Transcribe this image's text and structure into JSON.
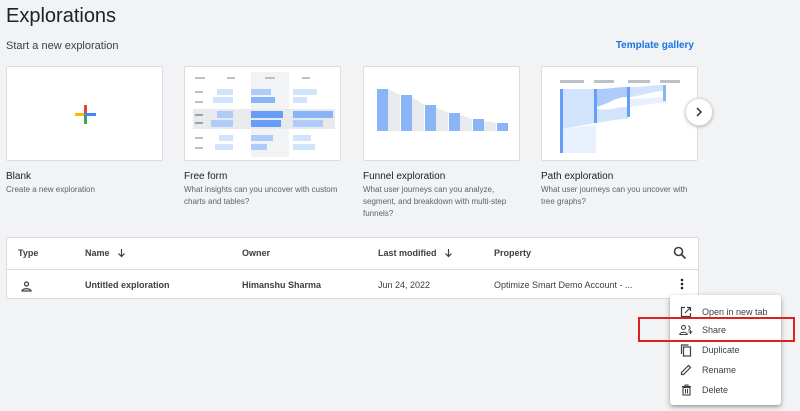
{
  "page": {
    "title": "Explorations"
  },
  "start_section": {
    "label": "Start a new exploration",
    "gallery_link": "Template gallery"
  },
  "templates": [
    {
      "title": "Blank",
      "description": "Create a new exploration"
    },
    {
      "title": "Free form",
      "description": "What insights can you uncover with custom charts and tables?"
    },
    {
      "title": "Funnel exploration",
      "description": "What user journeys can you analyze, segment, and breakdown with multi-step funnels?"
    },
    {
      "title": "Path exploration",
      "description": "What user journeys can you uncover with tree graphs?"
    }
  ],
  "table": {
    "headers": {
      "type": "Type",
      "name": "Name",
      "owner": "Owner",
      "last_modified": "Last modified",
      "property": "Property"
    },
    "rows": [
      {
        "type_icon": "person-icon",
        "name": "Untitled exploration",
        "owner": "Himanshu Sharma",
        "last_modified": "Jun 24, 2022",
        "property": "Optimize Smart Demo Account - ..."
      }
    ]
  },
  "context_menu": {
    "items": [
      {
        "label": "Open in new tab",
        "icon": "open-in-new-icon"
      },
      {
        "label": "Share",
        "icon": "share-person-icon"
      },
      {
        "label": "Duplicate",
        "icon": "duplicate-icon"
      },
      {
        "label": "Rename",
        "icon": "pencil-icon"
      },
      {
        "label": "Delete",
        "icon": "trash-icon"
      }
    ]
  },
  "colors": {
    "accent": "#1a73e8",
    "highlight": "#e02020",
    "bar_blue": "#8ab4f8"
  }
}
